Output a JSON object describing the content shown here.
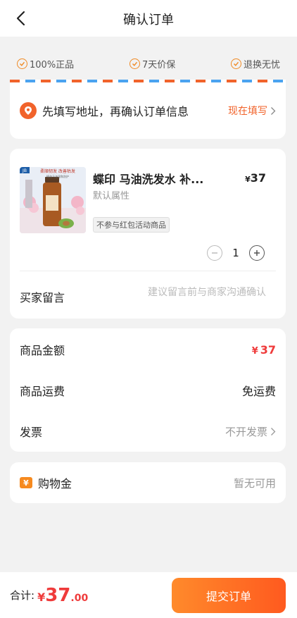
{
  "header": {
    "title": "确认订单",
    "back_icon": "chevron-left-icon"
  },
  "guarantees": [
    {
      "label": "100%正品",
      "icon": "check-circle-icon"
    },
    {
      "label": "7天价保",
      "icon": "check-circle-icon"
    },
    {
      "label": "退换无忧",
      "icon": "check-circle-icon"
    }
  ],
  "address": {
    "prompt": "先填写地址，再确认订单信息",
    "action": "现在填写",
    "icon": "location-pin-icon",
    "accent": "#f1632b"
  },
  "product": {
    "name": "蝶印 马油洗发水 补...",
    "attribute": "默认属性",
    "currency": "¥",
    "price": "37",
    "promo_tag": "不参与红包活动商品",
    "quantity": "1",
    "image_text": {
      "badge": "JB",
      "slogan": "柔順韧发 改善枯发",
      "subline": "精选马油温和洗护"
    }
  },
  "message": {
    "label": "买家留言",
    "placeholder": "建议留言前与商家沟通确认"
  },
  "summary": {
    "goods_label": "商品金额",
    "goods_currency": "¥",
    "goods_value": "37",
    "shipping_label": "商品运费",
    "shipping_value": "免运费",
    "invoice_label": "发票",
    "invoice_value": "不开发票"
  },
  "coupon": {
    "label": "购物金",
    "value": "暂无可用",
    "icon_glyph": "¥"
  },
  "footer": {
    "total_label": "合计:",
    "currency": "¥",
    "total_int": "37",
    "total_dec": ".00",
    "submit_label": "提交订单",
    "accent": "#ef3b3b"
  }
}
